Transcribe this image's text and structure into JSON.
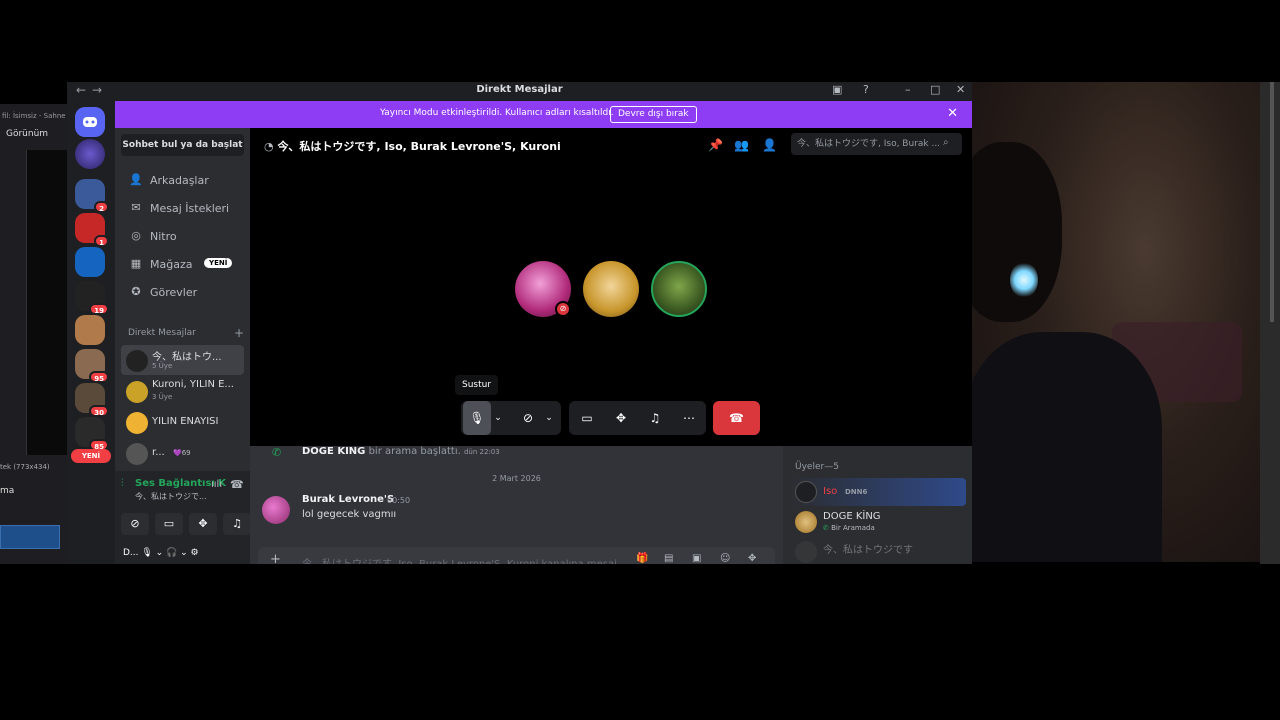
{
  "window": {
    "title": "Direkt Mesajlar"
  },
  "left_app": {
    "title_fragment": "fil: İsimsiz - Sahne",
    "menu": "Görünüm",
    "size_text": "tek (773x434)",
    "label": "ma"
  },
  "banner": {
    "message": "Yayıncı Modu etkinleştirildi. Kullanıcı adları kısaltıldı.",
    "button": "Devre dışı bırak"
  },
  "servers": [
    {
      "name": "discord-home",
      "badge": ""
    },
    {
      "name": "server-1",
      "badge": ""
    },
    {
      "name": "server-2",
      "badge": "2"
    },
    {
      "name": "server-3",
      "badge": "1"
    },
    {
      "name": "server-4",
      "badge": ""
    },
    {
      "name": "server-5",
      "badge": "19"
    },
    {
      "name": "server-6",
      "badge": ""
    },
    {
      "name": "server-7",
      "badge": "95"
    },
    {
      "name": "server-8",
      "badge": "30"
    },
    {
      "name": "server-9",
      "badge": "85"
    }
  ],
  "rail_new": "YENİ",
  "sidebar": {
    "search": "Sohbet bul ya da başlat",
    "nav": [
      {
        "label": "Arkadaşlar",
        "icon": "friends-icon"
      },
      {
        "label": "Mesaj İstekleri",
        "icon": "mail-icon"
      },
      {
        "label": "Nitro",
        "icon": "nitro-icon"
      },
      {
        "label": "Mağaza",
        "icon": "shop-icon",
        "badge": "YENİ"
      },
      {
        "label": "Görevler",
        "icon": "quests-icon"
      }
    ],
    "dm_header": "Direkt Mesajlar",
    "dms": [
      {
        "name": "今、私はトウ...",
        "sub": "5 Üye"
      },
      {
        "name": "Kuroni, YILIN E...",
        "sub": "3 Üye"
      },
      {
        "name": "YILIN ENAYİSİ",
        "sub": ""
      },
      {
        "name": "r...",
        "sub": "",
        "boost": "69"
      }
    ],
    "voice": {
      "title": "Ses Bağlantısı K",
      "channel": "今、私はトウジで..."
    },
    "user": "D..."
  },
  "call": {
    "header": "今、私はトウジです, Iso, Burak Levrone'S, Kuroni",
    "tooltip": "Sustur"
  },
  "chat": {
    "call_line_user": "DOGE KING",
    "call_line_text": "bir arama başlattı.",
    "call_line_time": "dün 22:03",
    "date_separator": "2 Mart 2026",
    "message": {
      "author": "Burak Levrone'S",
      "time": "00:50",
      "text": "lol gegecek vagmıı"
    },
    "input_placeholder": "今、私はトウジです, Iso, Burak Levrone'S, Kuroni kanalına mesaj"
  },
  "members": {
    "search_placeholder": "今、私はトウジです, Iso, Burak ...",
    "title": "Üyeler—5",
    "list": [
      {
        "name": "Iso",
        "status": "DNN6"
      },
      {
        "name": "DOGE KİNG",
        "status": "Bir Aramada"
      },
      {
        "name": "今、私はトウジです",
        "status": ""
      }
    ]
  },
  "colors": {
    "accent": "#8e3df5",
    "danger": "#da373c",
    "online": "#23a55a"
  }
}
